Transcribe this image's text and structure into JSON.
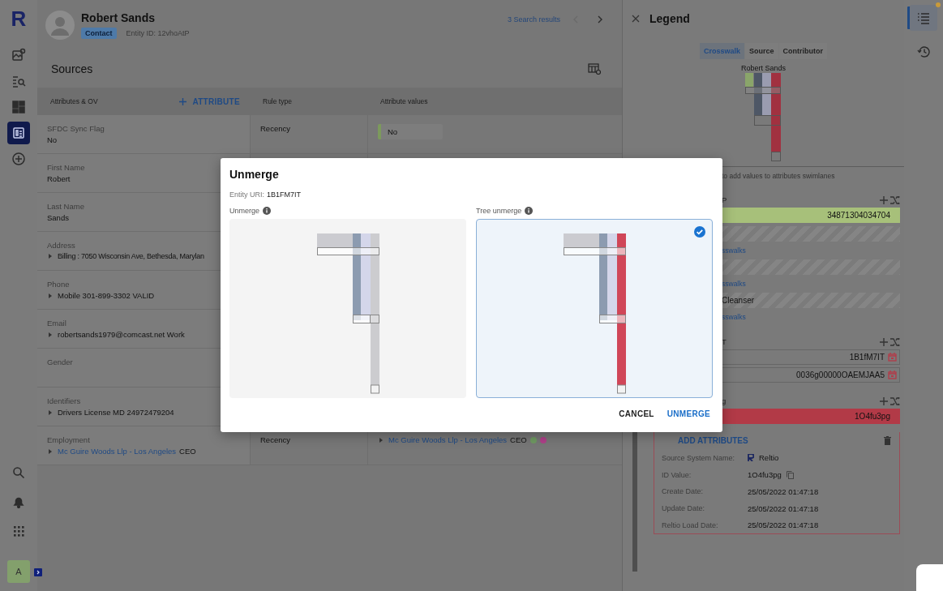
{
  "nav": {
    "logo": "R",
    "items": [
      {
        "kind": "map",
        "selected": false
      },
      {
        "kind": "search-list",
        "selected": false
      },
      {
        "kind": "dashboard",
        "selected": false
      },
      {
        "kind": "profile",
        "selected": true
      },
      {
        "kind": "add",
        "selected": false
      }
    ],
    "bottom": [
      {
        "kind": "search"
      },
      {
        "kind": "bell"
      },
      {
        "kind": "apps"
      }
    ],
    "user": {
      "initial": "A"
    }
  },
  "profile": {
    "name": "Robert Sands",
    "type": "Contact",
    "entity_id": "Entity ID: 12vhoAtP",
    "search_results": "3 Search results",
    "prev_disabled": true
  },
  "sources": {
    "title": "Sources",
    "columns": [
      "Attributes & OV",
      "Rule type",
      "Attribute values"
    ],
    "add_button": "ATTRIBUTE",
    "rows": [
      {
        "label": "SFDC Sync Flag",
        "value": {
          "text": "No",
          "expandable": false
        },
        "rule_type": "Recency",
        "attribute_value": {
          "kind": "chip",
          "text": "No"
        }
      },
      {
        "label": "First Name",
        "value": {
          "text": "Robert",
          "expandable": false
        }
      },
      {
        "label": "Last Name",
        "value": {
          "text": "Sands",
          "expandable": false
        }
      },
      {
        "label": "Address",
        "value": {
          "text": "Billing : 7050 Wisconsin Ave, Bethesda, Marylan",
          "expandable": true
        }
      },
      {
        "label": "Phone",
        "value": {
          "text": "Mobile 301-899-3302 VALID",
          "expandable": true
        }
      },
      {
        "label": "Email",
        "value": {
          "text": "robertsands1979@comcast.net Work",
          "expandable": true
        }
      },
      {
        "label": "Gender"
      },
      {
        "label": "Identifiers",
        "value": {
          "text": "Drivers License MD 24972479204",
          "expandable": true
        }
      },
      {
        "label": "Employment",
        "value": {
          "link": "Mc Guire Woods Llp - Los Angeles",
          "text": "CEO",
          "expandable": true
        },
        "rule_type": "Recency",
        "attribute_value": {
          "kind": "link",
          "link": "Mc Guire Woods Llp - Los Angeles",
          "text": "CEO",
          "sources": [
            {
              "color": "#6f9a62"
            },
            {
              "color": "#b0408a"
            }
          ]
        }
      }
    ]
  },
  "legend": {
    "title": "Legend",
    "tabs": [
      {
        "label": "Crosswalk",
        "selected": true
      },
      {
        "label": "Source",
        "selected": false
      },
      {
        "label": "Contributor",
        "selected": false
      }
    ],
    "entity_name": "Robert Sands",
    "hint": "to add values to attributes swimlanes",
    "groups": [
      {
        "title": "P",
        "lanes": [
          {
            "kind": "value",
            "text": "34871304034704",
            "color": "#a7c07a"
          },
          {
            "kind": "hatched"
          },
          {
            "kind": "link",
            "text": "sswalks"
          },
          {
            "kind": "hatched"
          },
          {
            "kind": "link",
            "text": "sswalks"
          },
          {
            "kind": "hatched",
            "text": "Cleanser"
          },
          {
            "kind": "link",
            "text": "sswalks"
          }
        ]
      },
      {
        "title": "T",
        "lanes": [
          {
            "kind": "id",
            "text": "1B1fM7IT"
          },
          {
            "kind": "id",
            "text": "0036g00000OAEMJAA5"
          }
        ]
      },
      {
        "title": "g",
        "lanes": [
          {
            "kind": "value",
            "text": "1O4fu3pg",
            "color": "#b23a47"
          }
        ]
      }
    ],
    "details": {
      "add_label": "ADD ATTRIBUTES",
      "fields": [
        {
          "kind": "source",
          "label": "Source System Name:",
          "value": "Reltio"
        },
        {
          "kind": "copy",
          "label": "ID Value:",
          "value": "1O4fu3pg"
        },
        {
          "kind": "text",
          "label": "Create Date:",
          "value": "25/05/2022 01:47:18"
        },
        {
          "kind": "text",
          "label": "Update Date:",
          "value": "25/05/2022 01:47:18"
        },
        {
          "kind": "text",
          "label": "Reltio Load Date:",
          "value": "25/05/2022 01:47:18"
        }
      ]
    }
  },
  "right_rail": [
    {
      "kind": "legend",
      "selected": true,
      "notification": true
    },
    {
      "kind": "history",
      "selected": false,
      "notification": false
    }
  ],
  "dialog": {
    "title": "Unmerge",
    "uri_label": "Entity URI:",
    "uri": "1B1FM7IT",
    "options": [
      {
        "kind": "unmerge",
        "label": "Unmerge",
        "selected": false
      },
      {
        "kind": "tree",
        "label": "Tree unmerge",
        "selected": true
      }
    ],
    "buttons": [
      {
        "kind": "secondary",
        "label": "CANCEL"
      },
      {
        "kind": "primary",
        "label": "UNMERGE"
      }
    ]
  }
}
